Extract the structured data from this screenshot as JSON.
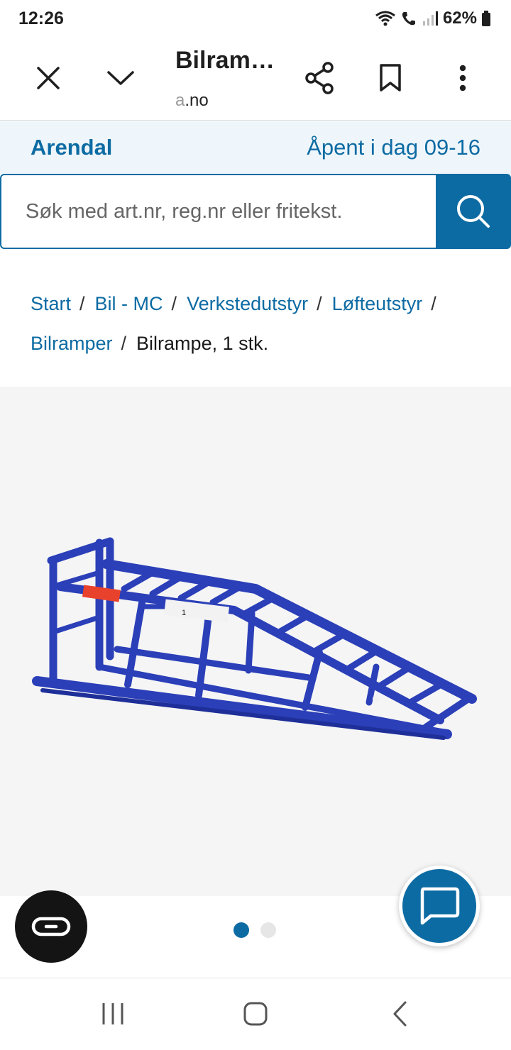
{
  "status_bar": {
    "time": "12:26",
    "battery": "62%"
  },
  "toolbar": {
    "title": "Bilram…",
    "url_faded": "a",
    "url_main": ".no"
  },
  "store": {
    "name": "Arendal",
    "hours": "Åpent i dag 09-16"
  },
  "search": {
    "placeholder": "Søk med art.nr, reg.nr eller fritekst."
  },
  "breadcrumb": {
    "items": [
      "Start",
      "Bil - MC",
      "Verkstedutstyr",
      "Løfteutstyr",
      "Bilramper"
    ],
    "separator": "/",
    "current": "Bilrampe, 1 stk."
  },
  "product": {
    "sticker_text": "1",
    "image_colors": {
      "ramp": "#2b3fb8",
      "ramp_dark": "#1e2f99",
      "label": "#e8412c"
    }
  },
  "carousel": {
    "total": 2,
    "active": 1
  },
  "colors": {
    "accent": "#0d6ba3",
    "banner_bg": "#eef6fb"
  },
  "icons": {
    "close": "close-icon",
    "collapse": "chevron-down-icon",
    "share": "share-icon",
    "bookmark": "bookmark-icon",
    "more": "more-vert-icon",
    "search": "search-icon",
    "chat": "chat-icon",
    "link": "link-icon"
  }
}
